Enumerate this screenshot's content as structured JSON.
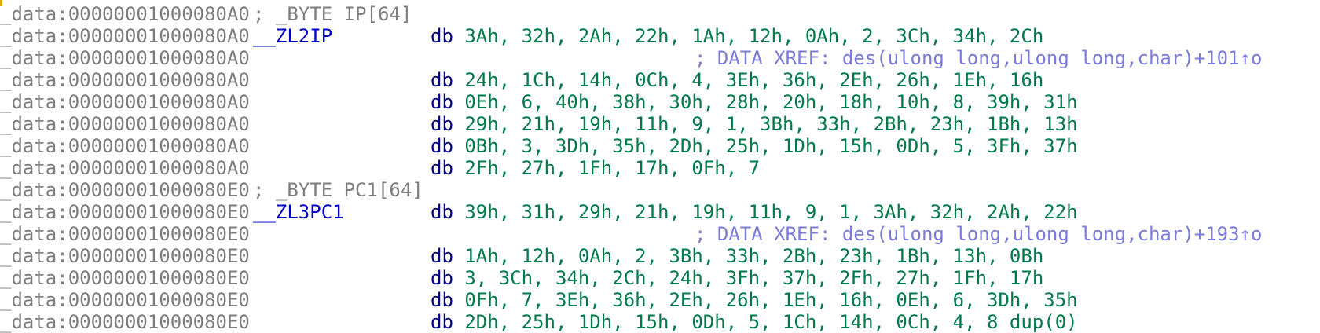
{
  "lines": [
    {
      "addr": "_data:00000001000080A0",
      "comment": "; _BYTE IP[64]",
      "label": "",
      "mnemonic": "",
      "operands": "",
      "xref": ""
    },
    {
      "addr": "_data:00000001000080A0",
      "comment": "",
      "label": "__ZL2IP",
      "mnemonic": "db",
      "operands": "3Ah, 32h, 2Ah, 22h, 1Ah, 12h, 0Ah, 2, 3Ch, 34h, 2Ch",
      "xref": ""
    },
    {
      "addr": "_data:00000001000080A0",
      "comment": "",
      "label": "",
      "mnemonic": "",
      "operands": "",
      "xref": "; DATA XREF: des(ulong long,ulong long,char)+101↑o"
    },
    {
      "addr": "_data:00000001000080A0",
      "comment": "",
      "label": "",
      "mnemonic": "db",
      "operands": "24h, 1Ch, 14h, 0Ch, 4, 3Eh, 36h, 2Eh, 26h, 1Eh, 16h",
      "xref": ""
    },
    {
      "addr": "_data:00000001000080A0",
      "comment": "",
      "label": "",
      "mnemonic": "db",
      "operands": "0Eh, 6, 40h, 38h, 30h, 28h, 20h, 18h, 10h, 8, 39h, 31h",
      "xref": ""
    },
    {
      "addr": "_data:00000001000080A0",
      "comment": "",
      "label": "",
      "mnemonic": "db",
      "operands": "29h, 21h, 19h, 11h, 9, 1, 3Bh, 33h, 2Bh, 23h, 1Bh, 13h",
      "xref": ""
    },
    {
      "addr": "_data:00000001000080A0",
      "comment": "",
      "label": "",
      "mnemonic": "db",
      "operands": "0Bh, 3, 3Dh, 35h, 2Dh, 25h, 1Dh, 15h, 0Dh, 5, 3Fh, 37h",
      "xref": ""
    },
    {
      "addr": "_data:00000001000080A0",
      "comment": "",
      "label": "",
      "mnemonic": "db",
      "operands": "2Fh, 27h, 1Fh, 17h, 0Fh, 7",
      "xref": ""
    },
    {
      "addr": "_data:00000001000080E0",
      "comment": "; _BYTE PC1[64]",
      "label": "",
      "mnemonic": "",
      "operands": "",
      "xref": ""
    },
    {
      "addr": "_data:00000001000080E0",
      "comment": "",
      "label": "__ZL3PC1",
      "mnemonic": "db",
      "operands": "39h, 31h, 29h, 21h, 19h, 11h, 9, 1, 3Ah, 32h, 2Ah, 22h",
      "xref": ""
    },
    {
      "addr": "_data:00000001000080E0",
      "comment": "",
      "label": "",
      "mnemonic": "",
      "operands": "",
      "xref": "; DATA XREF: des(ulong long,ulong long,char)+193↑o"
    },
    {
      "addr": "_data:00000001000080E0",
      "comment": "",
      "label": "",
      "mnemonic": "db",
      "operands": "1Ah, 12h, 0Ah, 2, 3Bh, 33h, 2Bh, 23h, 1Bh, 13h, 0Bh",
      "xref": ""
    },
    {
      "addr": "_data:00000001000080E0",
      "comment": "",
      "label": "",
      "mnemonic": "db",
      "operands": "3, 3Ch, 34h, 2Ch, 24h, 3Fh, 37h, 2Fh, 27h, 1Fh, 17h",
      "xref": ""
    },
    {
      "addr": "_data:00000001000080E0",
      "comment": "",
      "label": "",
      "mnemonic": "db",
      "operands": "0Fh, 7, 3Eh, 36h, 2Eh, 26h, 1Eh, 16h, 0Eh, 6, 3Dh, 35h",
      "xref": ""
    },
    {
      "addr": "_data:00000001000080E0",
      "comment": "",
      "label": "",
      "mnemonic": "db",
      "operands": "2Dh, 25h, 1Dh, 15h, 0Dh, 5, 1Ch, 14h, 0Ch, 4, 8 dup(0)",
      "xref": ""
    }
  ],
  "colors": {
    "address": "#7d7d7d",
    "comment": "#7d7d7d",
    "label": "#0000c8",
    "mnemonic": "#000080",
    "operands": "#007a4a",
    "xref": "#7b7bd9",
    "cursor": "#d6b000"
  }
}
